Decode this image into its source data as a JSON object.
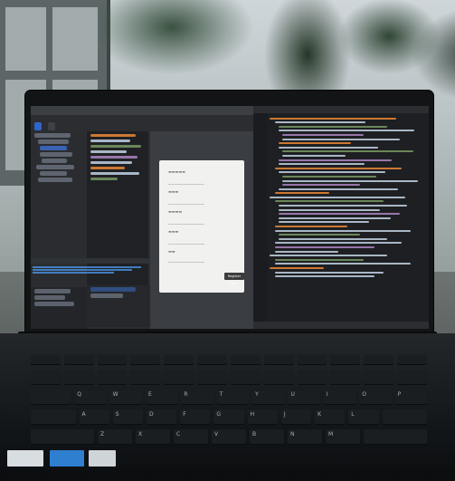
{
  "photo": {
    "subject": "laptop on outdoor table showing IDE and code editor"
  },
  "screen_left": {
    "tabs": [
      "",
      ""
    ],
    "form_preview": {
      "button_label": "Register User"
    }
  },
  "keyboard": {
    "row_top": [
      "Q",
      "W",
      "E",
      "R",
      "T",
      "Y",
      "U",
      "I",
      "O",
      "P"
    ],
    "row_mid": [
      "A",
      "S",
      "D",
      "F",
      "G",
      "H",
      "J",
      "K",
      "L"
    ],
    "row_bot": [
      "Z",
      "X",
      "C",
      "V",
      "B",
      "N",
      "M"
    ]
  },
  "colors": {
    "accent_blue": "#2f65ca",
    "screen_bg": "#1e1f22"
  }
}
